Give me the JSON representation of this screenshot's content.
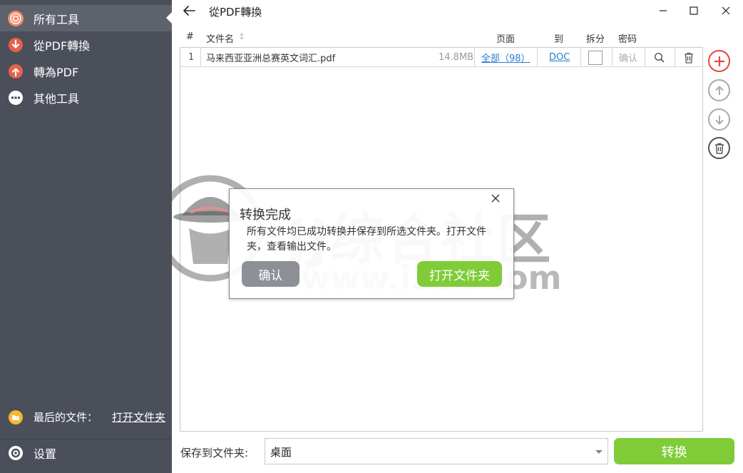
{
  "sidebar": {
    "items": [
      {
        "label": "所有工具",
        "icon": "all-tools-icon"
      },
      {
        "label": "從PDF轉換",
        "icon": "from-pdf-icon"
      },
      {
        "label": "轉為PDF",
        "icon": "to-pdf-icon"
      },
      {
        "label": "其他工具",
        "icon": "more-icon"
      }
    ],
    "recent": {
      "label": "最后的文件：",
      "link": "打开文件夹"
    },
    "settings": {
      "label": "设置"
    }
  },
  "window": {
    "title": "從PDF轉換"
  },
  "table": {
    "headers": {
      "num": "#",
      "name": "文件名",
      "pages": "页面",
      "to": "到",
      "split": "拆分",
      "password": "密码"
    },
    "rows": [
      {
        "num": "1",
        "name": "马来西亚亚洲总赛英文词汇.pdf",
        "size": "14.8MB",
        "pages": "全部（98）",
        "format": "DOC",
        "password": "确认"
      }
    ]
  },
  "dialog": {
    "title": "转换完成",
    "message": "所有文件均已成功转换并保存到所选文件夹。打开文件夹，查看输出文件。",
    "confirm": "确认",
    "open_folder": "打开文件夹"
  },
  "watermark": {
    "text": "JJ综合社区",
    "url": "www.i3zh.com"
  },
  "bottom": {
    "save_label": "保存到文件夹:",
    "save_value": "桌面",
    "convert": "转换"
  },
  "colors": {
    "sidebar_bg": "#4a4f59",
    "accent_green": "#7fcc38",
    "link_blue": "#2a7ecb",
    "add_red": "#e8453c"
  }
}
